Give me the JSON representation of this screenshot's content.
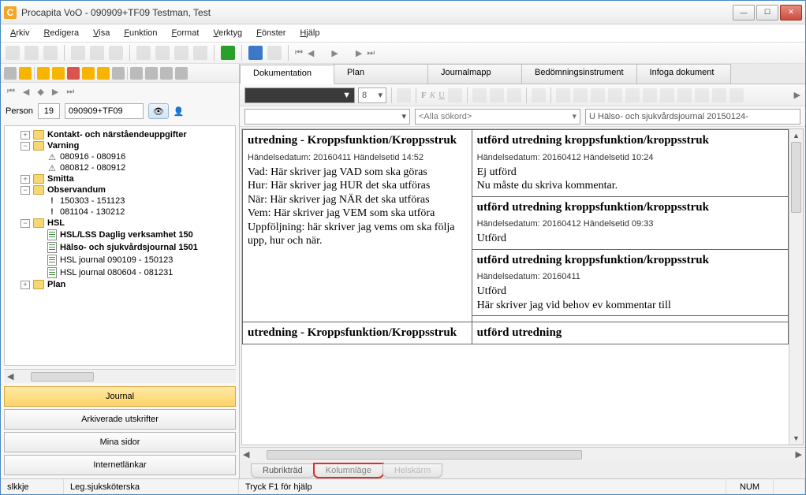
{
  "window": {
    "title": "Procapita VoO - 090909+TF09 Testman, Test"
  },
  "menu": [
    "Arkiv",
    "Redigera",
    "Visa",
    "Funktion",
    "Format",
    "Verktyg",
    "Fönster",
    "Hjälp"
  ],
  "person": {
    "label": "Person",
    "num": "19",
    "id": "090909+TF09"
  },
  "tree": {
    "kontakt": "Kontakt- och närståendeuppgifter",
    "varning": "Varning",
    "varning_items": [
      "080916 - 080916",
      "080812 - 080912"
    ],
    "smitta": "Smitta",
    "observandum": "Observandum",
    "obs_items": [
      "150303 - 151123",
      "081104 - 130212"
    ],
    "hsl": "HSL",
    "hsl_items": [
      "HSL/LSS Daglig verksamhet 150",
      "Hälso- och sjukvårdsjournal 1501",
      "HSL journal 090109 - 150123",
      "HSL journal 080604 - 081231"
    ],
    "plan": "Plan"
  },
  "left_buttons": [
    "Journal",
    "Arkiverade utskrifter",
    "Mina sidor",
    "Internetlänkar"
  ],
  "tabs": [
    "Dokumentation",
    "Plan",
    "Journalmapp",
    "Bedömningsinstrument",
    "Infoga dokument"
  ],
  "format": {
    "size": "8"
  },
  "filters": {
    "sokord_placeholder": "<Alla sökord>",
    "journal": "U Hälso- och sjukvårdsjournal 20150124-"
  },
  "col_left": {
    "title": "utredning - Kroppsfunktion/Kroppsstruk",
    "meta": "Händelsedatum: 20160411 Händelsetid 14:52",
    "l1": "Vad: Här skriver jag VAD som ska göras",
    "l2": "Hur: Här skriver jag HUR det ska utföras",
    "l3": "När: Här skriver jag NÄR det ska utföras",
    "l4": "Vem: Här skriver jag VEM som ska utföra",
    "l5": "Uppföljning: här skriver jag vems om ska följa upp, hur och när.",
    "title2": "utredning - Kroppsfunktion/Kroppsstruk"
  },
  "col_right": {
    "c1": {
      "title": "utförd utredning kroppsfunktion/kroppsstruk",
      "meta": "Händelsedatum: 20160412 Händelsetid 10:24",
      "s1": "Ej utförd",
      "s2": "Nu måste du skriva kommentar."
    },
    "c2": {
      "title": "utförd utredning kroppsfunktion/kroppsstruk",
      "meta": "Händelsedatum: 20160412 Händelsetid 09:33",
      "s1": "Utförd"
    },
    "c3": {
      "title": "utförd utredning kroppsfunktion/kroppsstruk",
      "meta": "Händelsedatum: 20160411",
      "s1": "Utförd",
      "s2": "Här skriver jag vid behov ev kommentar till"
    },
    "c4": {
      "title": "utförd utredning"
    }
  },
  "bottom_tabs": [
    "Rubrikträd",
    "Kolumnläge",
    "Helskärm"
  ],
  "status": {
    "left": "slkkje",
    "role": "Leg.sjuksköterska",
    "help": "Tryck F1 för hjälp",
    "num": "NUM"
  }
}
